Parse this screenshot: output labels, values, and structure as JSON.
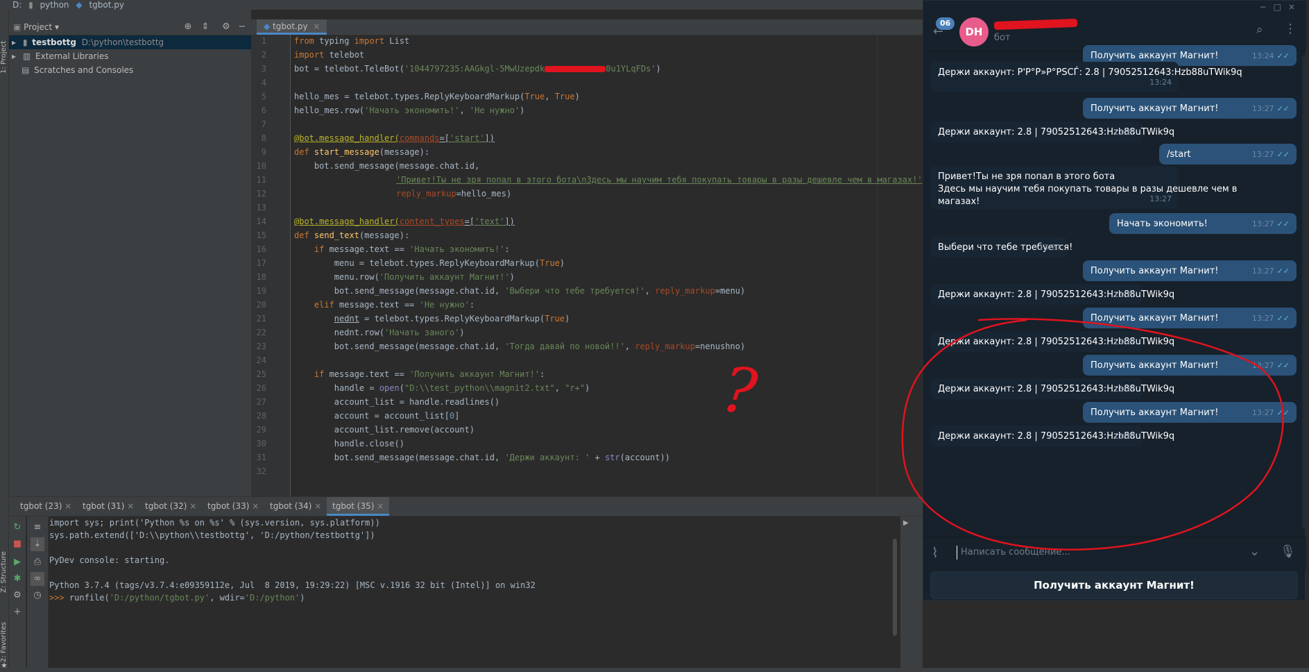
{
  "ide": {
    "breadcrumbs": [
      "D:",
      "python",
      "tgbot.py"
    ],
    "project_panel": {
      "title": "Project",
      "tree": [
        {
          "name": "testbottg",
          "path": "D:\\python\\testbottg"
        },
        {
          "name": "External Libraries"
        },
        {
          "name": "Scratches and Consoles"
        }
      ]
    },
    "side_labels": {
      "project": "1: Project",
      "structure": "Z: Structure",
      "favorites": "2: Favorites"
    },
    "editor_tab": "tgbot.py",
    "line_numbers": [
      "1",
      "2",
      "3",
      "4",
      "5",
      "6",
      "7",
      "8",
      "9",
      "10",
      "11",
      "12",
      "13",
      "14",
      "15",
      "16",
      "17",
      "18",
      "19",
      "20",
      "21",
      "22",
      "23",
      "24",
      "25",
      "26",
      "27",
      "28",
      "29",
      "30",
      "31",
      "32"
    ],
    "code": {
      "l1a": "from",
      "l1b": " typing ",
      "l1c": "import",
      "l1d": " List",
      "l2a": "import",
      "l2b": " telebot",
      "l3a": "bot = telebot.TeleBot(",
      "l3b": "'1044797235:AAGkgl-5MwUzepdk",
      "l3c": "0u1YLqFDs'",
      "l3d": ")",
      "l5a": "hello_mes = telebot.types.ReplyKeyboardMarkup(",
      "l5b": "True",
      "l5c": ", ",
      "l5d": "True",
      "l5e": ")",
      "l6a": "hello_mes.row(",
      "l6b": "'Начать экономить!'",
      "l6c": ", ",
      "l6d": "'Не нужно'",
      "l6e": ")",
      "l8a": "@bot.message_handler(",
      "l8b": "commands",
      "l8c": "=[",
      "l8d": "'start'",
      "l8e": "])",
      "l9a": "def",
      "l9b": " start_message",
      "l9c": "(message):",
      "l10a": "    bot.send_message(message.chat.id,",
      "l11a": "'Привет!Ты не зря попал в этого бота\\nЗдесь мы научим тебя покупать товары в разы дешевле чем в магазах!'",
      "l11b": ",",
      "l12a": "reply_markup",
      "l12b": "=hello_mes)",
      "l14a": "@bot.message_handler(",
      "l14b": "content_types",
      "l14c": "=[",
      "l14d": "'text'",
      "l14e": "])",
      "l15a": "def",
      "l15b": " send_text",
      "l15c": "(message):",
      "l16a": "    ",
      "l16b": "if",
      "l16c": " message.text == ",
      "l16d": "'Начать экономить!'",
      "l16e": ":",
      "l17a": "        menu = telebot.types.ReplyKeyboardMarkup(",
      "l17b": "True",
      "l17c": ")",
      "l18a": "        menu.row(",
      "l18b": "'Получить аккаунт Магнит!'",
      "l18c": ")",
      "l19a": "        bot.send_message(message.chat.id, ",
      "l19b": "'Выбери что тебе требуется!'",
      "l19c": ", ",
      "l19d": "reply_markup",
      "l19e": "=menu)",
      "l20a": "    ",
      "l20b": "elif",
      "l20c": " message.text == ",
      "l20d": "'Не нужно'",
      "l20e": ":",
      "l21a": "        ",
      "l21b": "nednt",
      "l21c": " = telebot.types.ReplyKeyboardMarkup(",
      "l21d": "True",
      "l21e": ")",
      "l22a": "        nednt.row(",
      "l22b": "'Начать заного'",
      "l22c": ")",
      "l23a": "        bot.send_message(message.chat.id, ",
      "l23b": "'Тогда давай по новой!!'",
      "l23c": ", ",
      "l23d": "reply_markup",
      "l23e": "=nenushno)",
      "l25a": "    ",
      "l25b": "if",
      "l25c": " message.text == ",
      "l25d": "'Получить аккаунт Магнит!'",
      "l25e": ":",
      "l26a": "        handle = ",
      "l26b": "open",
      "l26c": "(",
      "l26d": "\"D:\\\\test_python\\\\magnit2.txt\"",
      "l26e": ", ",
      "l26f": "\"r+\"",
      "l26g": ")",
      "l27a": "        account_list = handle.readlines()",
      "l28a": "        account = account_list[",
      "l28b": "0",
      "l28c": "]",
      "l29a": "        account_list.remove(account)",
      "l30a": "        handle.close()",
      "l31a": "        bot.send_message(message.chat.id, ",
      "l31b": "'Держи аккаунт: '",
      "l31c": " + ",
      "l31d": "str",
      "l31e": "(account))"
    },
    "annotation": "?",
    "run_tabs": [
      "tgbot (23)",
      "tgbot (31)",
      "tgbot (32)",
      "tgbot (33)",
      "tgbot (34)",
      "tgbot (35)"
    ],
    "console": {
      "l1": "import sys; print('Python %s on %s' % (sys.version, sys.platform))",
      "l2": "sys.path.extend(['D:\\\\python\\\\testbottg', 'D:/python/testbottg'])",
      "l3": "PyDev console: starting.",
      "l4": "Python 3.7.4 (tags/v3.7.4:e09359112e, Jul  8 2019, 19:29:22) [MSC v.1916 32 bit (Intel)] on win32",
      "prompt": ">>> ",
      "l5a": "runfile(",
      "l5b": "'D:/python/tgbot.py'",
      "l5c": ", wdir=",
      "l5d": "'D:/python'",
      "l5e": ")"
    }
  },
  "telegram": {
    "badge": "06",
    "avatar_initials": "DH",
    "subtitle": "бот",
    "messages": [
      {
        "dir": "out",
        "text": "Получить аккаунт Магнит!",
        "time": "13:24"
      },
      {
        "dir": "in",
        "text": "Держи аккаунт: Р'Р°Р»Р°РЅСЃ: 2.8 | 79052512643:Hzb88uTWik9q",
        "time": "13:24"
      },
      {
        "dir": "out",
        "text": "Получить аккаунт Магнит!",
        "time": "13:27"
      },
      {
        "dir": "in",
        "text": "Держи аккаунт:  2.8 | 79052512643:Hzb88uTWik9q",
        "time": "13:27"
      },
      {
        "dir": "out",
        "text": "/start",
        "time": "13:27"
      },
      {
        "dir": "in",
        "line1": "Привет!Ты не зря попал в этого бота",
        "line2": "Здесь мы научим тебя покупать товары в разы дешевле чем в",
        "line3": "магазах!",
        "time": "13:27"
      },
      {
        "dir": "out",
        "text": "Начать экономить!",
        "time": "13:27"
      },
      {
        "dir": "in",
        "text": "Выбери что тебе требуется!",
        "time": "13:27"
      },
      {
        "dir": "out",
        "text": "Получить аккаунт Магнит!",
        "time": "13:27"
      },
      {
        "dir": "in",
        "text": "Держи аккаунт:  2.8 | 79052512643:Hzb88uTWik9q",
        "time": "13:27"
      },
      {
        "dir": "out",
        "text": "Получить аккаунт Магнит!",
        "time": "13:27"
      },
      {
        "dir": "in",
        "text": "Держи аккаунт:  2.8 | 79052512643:Hzb88uTWik9q",
        "time": "13:27"
      },
      {
        "dir": "out",
        "text": "Получить аккаунт Магнит!",
        "time": "13:27"
      },
      {
        "dir": "in",
        "text": "Держи аккаунт:  2.8 | 79052512643:Hzb88uTWik9q",
        "time": "13:27"
      },
      {
        "dir": "out",
        "text": "Получить аккаунт Магнит!",
        "time": "13:27"
      },
      {
        "dir": "in",
        "text": "Держи аккаунт:  2.8 | 79052512643:Hzb88uTWik9q",
        "time": "13:27"
      }
    ],
    "input_placeholder": "Написать сообщение...",
    "keyboard_button": "Получить аккаунт Магнит!",
    "colors": {
      "outgoing": "#2b5278",
      "incoming": "#182533",
      "annotation": "#e0141e"
    }
  }
}
